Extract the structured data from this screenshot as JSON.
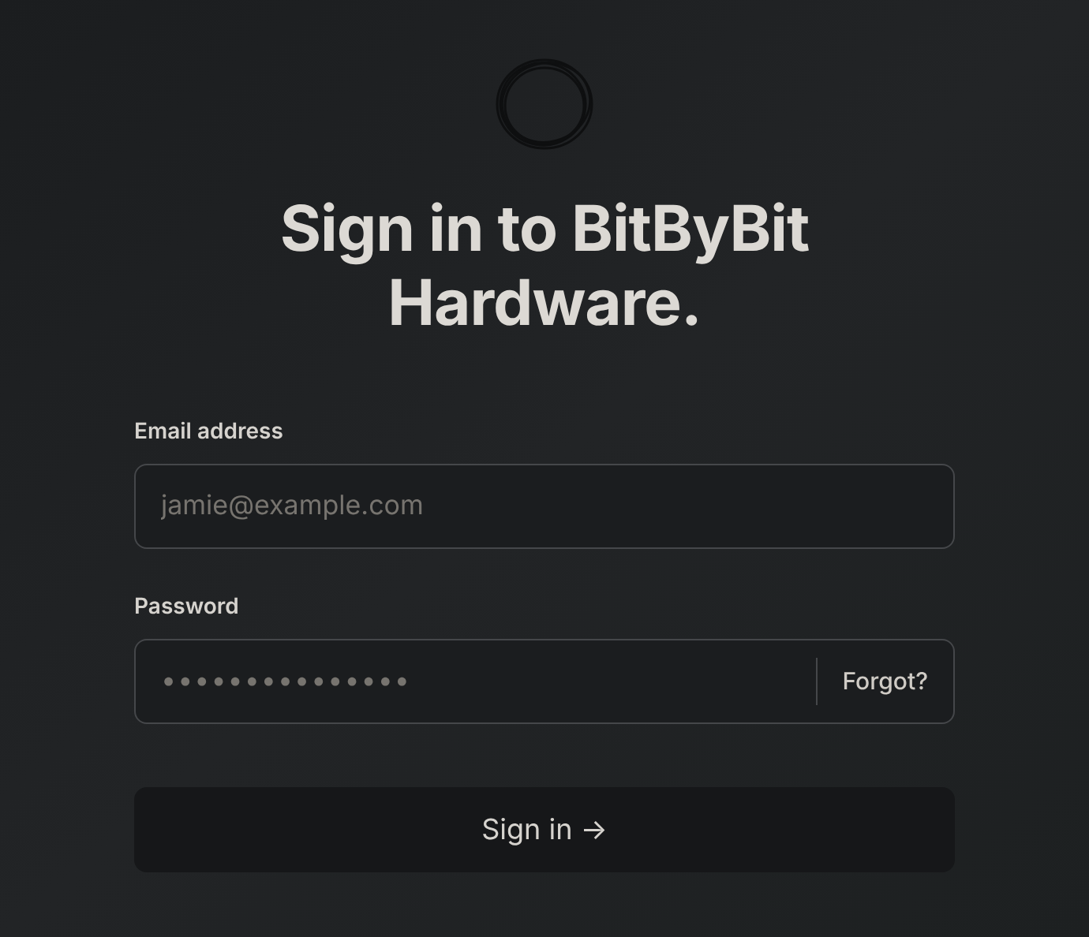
{
  "title": "Sign in to BitByBit Hardware.",
  "email": {
    "label": "Email address",
    "placeholder": "jamie@example.com"
  },
  "password": {
    "label": "Password",
    "placeholder": "•••••••••••••••",
    "forgot": "Forgot?"
  },
  "submit": "Sign in →"
}
